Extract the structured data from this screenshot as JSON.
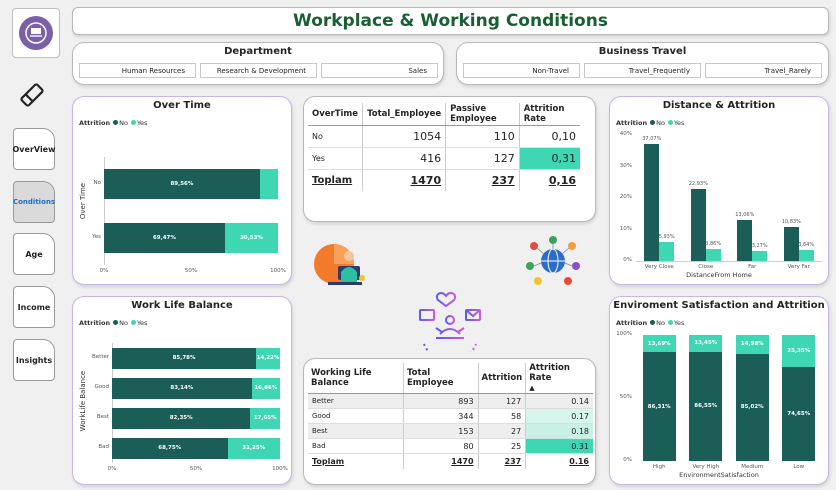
{
  "header": {
    "title": "Workplace & Working Conditions"
  },
  "nav": {
    "items": [
      {
        "label": "OverView",
        "active": false
      },
      {
        "label": "Conditions",
        "active": true
      },
      {
        "label": "Age",
        "active": false
      },
      {
        "label": "Income",
        "active": false
      },
      {
        "label": "Insights",
        "active": false
      }
    ]
  },
  "department": {
    "title": "Department",
    "options": [
      "Human Resources",
      "Research & Development",
      "Sales"
    ]
  },
  "travel": {
    "title": "Business Travel",
    "options": [
      "Non-Travel",
      "Travel_Frequently",
      "Travel_Rarely"
    ]
  },
  "legend": {
    "title": "Attrition",
    "no": "No",
    "yes": "Yes"
  },
  "colors": {
    "no": "#1a5e57",
    "yes": "#3fd6b4",
    "accent": "#1d6ec9",
    "title": "#1a5e34"
  },
  "overtime_table": {
    "headers": [
      "OverTime",
      "Total_Employee",
      "Passive Employee",
      "Attrition Rate"
    ],
    "rows": [
      [
        "No",
        "1054",
        "110",
        "0,10"
      ],
      [
        "Yes",
        "416",
        "127",
        "0,31"
      ]
    ],
    "total": [
      "Toplam",
      "1470",
      "237",
      "0,16"
    ]
  },
  "wlb_table": {
    "headers": [
      "Working Life Balance",
      "Total Employee",
      "Attrition",
      "Attrition Rate"
    ],
    "rows": [
      [
        "Better",
        "893",
        "127",
        "0.14"
      ],
      [
        "Good",
        "344",
        "58",
        "0.17"
      ],
      [
        "Best",
        "153",
        "27",
        "0.18"
      ],
      [
        "Bad",
        "80",
        "25",
        "0.31"
      ]
    ],
    "total": [
      "Toplam",
      "1470",
      "237",
      "0.16"
    ]
  },
  "chart_data": [
    {
      "type": "bar",
      "orientation": "horizontal",
      "stacked": "100%",
      "title": "Over Time",
      "ylabel": "Over Time",
      "categories": [
        "No",
        "Yes"
      ],
      "series": [
        {
          "name": "No",
          "values": [
            89.56,
            69.47
          ],
          "labels": [
            "89,56%",
            "69,47%"
          ]
        },
        {
          "name": "Yes",
          "values": [
            10.44,
            30.53
          ],
          "labels": [
            "",
            "30,53%"
          ]
        }
      ],
      "xticks": [
        "0%",
        "50%",
        "100%"
      ],
      "legend": "top-left"
    },
    {
      "type": "bar",
      "orientation": "horizontal",
      "stacked": "100%",
      "title": "Work Life Balance",
      "ylabel": "WorkLife Balance",
      "categories": [
        "Better",
        "Good",
        "Best",
        "Bad"
      ],
      "series": [
        {
          "name": "No",
          "values": [
            85.78,
            83.14,
            82.35,
            68.75
          ],
          "labels": [
            "85,78%",
            "83,14%",
            "82,35%",
            "68,75%"
          ]
        },
        {
          "name": "Yes",
          "values": [
            14.22,
            16.86,
            17.65,
            31.25
          ],
          "labels": [
            "14,22%",
            "16,86%",
            "17,65%",
            "31,25%"
          ]
        }
      ],
      "xticks": [
        "0%",
        "50%",
        "100%"
      ],
      "legend": "top-left"
    },
    {
      "type": "bar",
      "orientation": "vertical",
      "title": "Distance & Attrition",
      "xlabel": "DistanceFrom Home",
      "categories": [
        "Very Close",
        "Close",
        "Far",
        "Very Far"
      ],
      "series": [
        {
          "name": "No",
          "values": [
            37.07,
            22.93,
            13.06,
            10.83
          ],
          "labels": [
            "37,07%",
            "22,93%",
            "13,06%",
            "10,83%"
          ]
        },
        {
          "name": "Yes",
          "values": [
            5.93,
            3.86,
            3.27,
            3.64
          ],
          "labels": [
            "5,93%",
            "3,86%",
            "3,27%",
            "3,64%"
          ]
        }
      ],
      "ylim": [
        0,
        40
      ],
      "yticks": [
        "0%",
        "10%",
        "20%",
        "30%",
        "40%"
      ],
      "legend": "top-left"
    },
    {
      "type": "bar",
      "orientation": "vertical",
      "stacked": "100%",
      "title": "Enviroment Satisfaction and Attrition",
      "xlabel": "EnvironmentSatisfaction",
      "categories": [
        "High",
        "Very High",
        "Medium",
        "Low"
      ],
      "series": [
        {
          "name": "No",
          "values": [
            86.31,
            86.55,
            85.02,
            74.65
          ],
          "labels": [
            "86,31%",
            "86,55%",
            "85,02%",
            "74,65%"
          ]
        },
        {
          "name": "Yes",
          "values": [
            13.69,
            13.45,
            14.98,
            25.35
          ],
          "labels": [
            "13,69%",
            "13,45%",
            "14,98%",
            "25,35%"
          ]
        }
      ],
      "yticks": [
        "0%",
        "50%",
        "100%"
      ],
      "legend": "top-left"
    }
  ]
}
